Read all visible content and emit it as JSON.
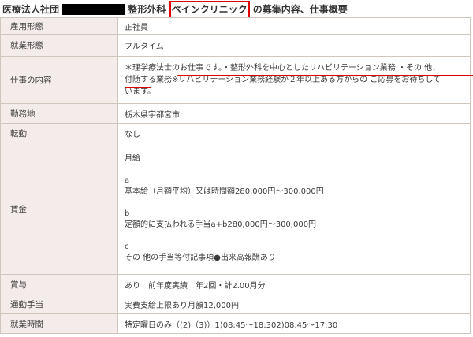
{
  "page_title": {
    "prefix": "医療法人社団",
    "dept": "整形外科",
    "clinic": "ペインクリニック",
    "suffix": "の募集内容、仕事概要"
  },
  "rows": {
    "employment_type": {
      "label": "雇用形態",
      "value": "正社員"
    },
    "work_style": {
      "label": "就業形態",
      "value": "フルタイム"
    },
    "job_content": {
      "label": "仕事の内容",
      "lines": [
        "＊理学療法士のお仕事です。・整形外科を中心としたリハビリテーション業務 ・その 他、",
        "付随する業務※リハビリテーション業務経験が２年以上ある方からの ご応募をお待ちして",
        "います。"
      ]
    },
    "location": {
      "label": "勤務地",
      "value": "栃木県宇都宮市"
    },
    "transfer": {
      "label": "転勤",
      "value": "なし"
    },
    "salary": {
      "label": "賃金",
      "lines": [
        "月給",
        "",
        "a",
        "基本給（月額平均）又は時間額280,000円〜300,000円",
        "",
        "b",
        "定額的に支払われる手当a+b280,000円〜300,000円",
        "",
        "c",
        "その 他の手当等付記事項●出来高報酬あり"
      ]
    },
    "bonus": {
      "label": "賞与",
      "value": "あり　前年度実績　年2回・計2.00月分"
    },
    "commute": {
      "label": "通勤手当",
      "value": "実費支給上限あり月額12,000円"
    },
    "hours": {
      "label": "就業時間",
      "value": "特定曜日のみ（(2)（3)）1)08:45〜18:302)08:45〜17:30"
    }
  },
  "colors": {
    "header_cell_bg": "#f3ecea",
    "border": "#cfc6bd",
    "highlight_red": "#e00000"
  }
}
